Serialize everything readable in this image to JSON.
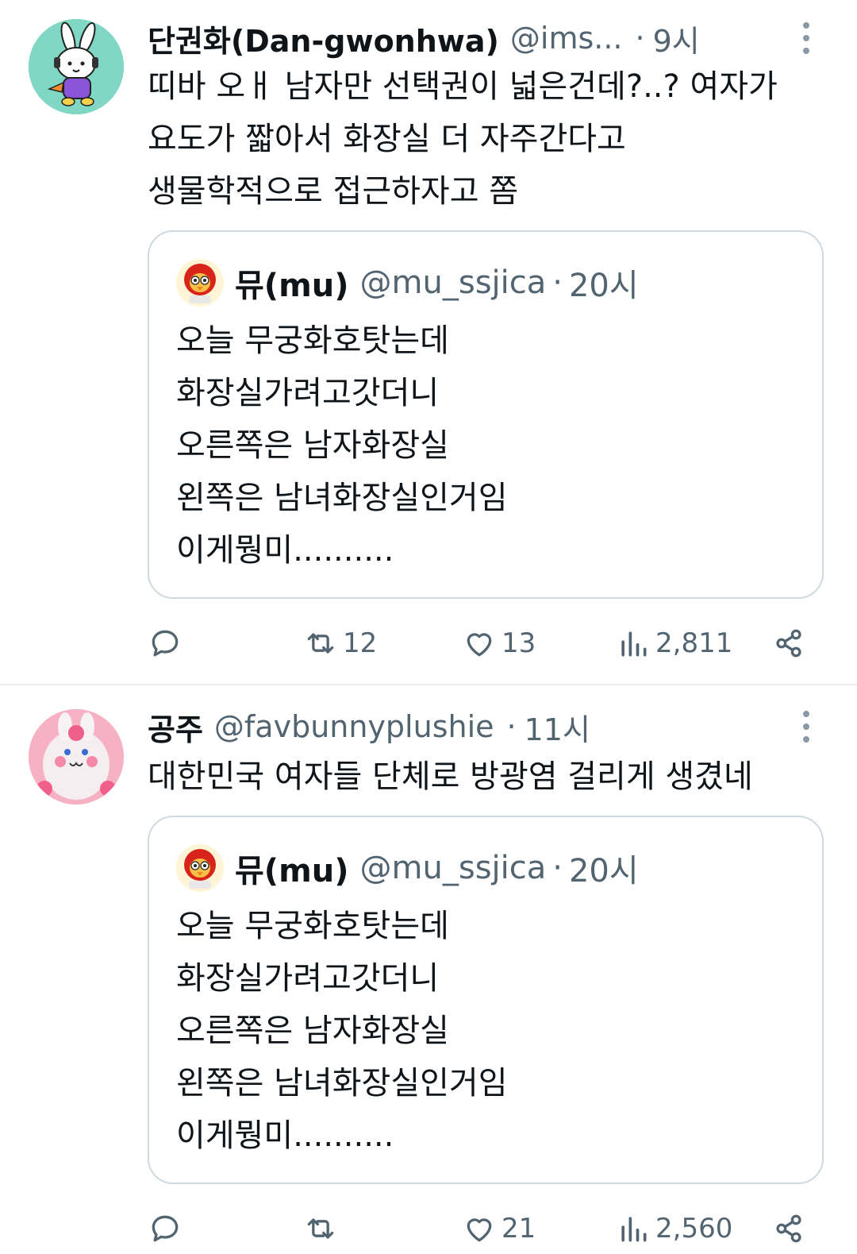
{
  "tweets": [
    {
      "author": {
        "name": "단권화(Dan-gwonhwa)",
        "handle": "@ims...",
        "time": "9시",
        "separator": "·"
      },
      "text_lines": [
        "띠바 오ㅐ 남자만 선택권이 넓은건데?..? 여자가",
        "요도가 짧아서 화장실 더 자주간다고",
        "생물학적으로 접근하자고 쫌"
      ],
      "quote": {
        "name": "뮤(mu)",
        "handle": "@mu_ssjica",
        "separator": "·",
        "time": "20시",
        "text_lines": [
          "오늘 무궁화호탓는데",
          "화장실가려고갓더니",
          "오른쪽은 남자화장실",
          "왼쪽은 남녀화장실인거임",
          "이게뭥미.........."
        ]
      },
      "actions": {
        "reply_count": "",
        "retweet_count": "12",
        "like_count": "13",
        "view_count": "2,811"
      }
    },
    {
      "author": {
        "name": "공주",
        "handle": "@favbunnyplushie",
        "time": "11시",
        "separator": "·"
      },
      "text_lines": [
        "대한민국 여자들 단체로 방광염 걸리게 생겼네"
      ],
      "quote": {
        "name": "뮤(mu)",
        "handle": "@mu_ssjica",
        "separator": "·",
        "time": "20시",
        "text_lines": [
          "오늘 무궁화호탓는데",
          "화장실가려고갓더니",
          "오른쪽은 남자화장실",
          "왼쪽은 남녀화장실인거임",
          "이게뭥미.........."
        ]
      },
      "actions": {
        "reply_count": "",
        "retweet_count": "",
        "like_count": "21",
        "view_count": "2,560"
      }
    }
  ],
  "icons": {
    "reply": "reply-icon",
    "retweet": "retweet-icon",
    "like": "heart-icon",
    "views": "views-icon",
    "share": "share-icon",
    "more": "more-icon"
  },
  "colors": {
    "text": "#0f1419",
    "secondary": "#536471",
    "border": "#cfd9de"
  }
}
